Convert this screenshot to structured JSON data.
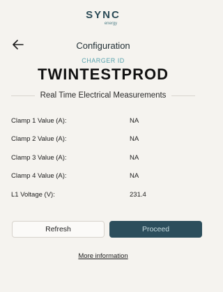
{
  "logo": {
    "word": "SYNC",
    "sub": "energy"
  },
  "header": {
    "title": "Configuration",
    "back_icon": "arrow-left-icon"
  },
  "charger": {
    "id_label": "CHARGER ID",
    "id_value": "TWINTESTPROD"
  },
  "section": {
    "title": "Real Time Electrical Measurements"
  },
  "measurements": [
    {
      "label": "Clamp 1 Value (A):",
      "value": "NA"
    },
    {
      "label": "Clamp 2 Value (A):",
      "value": "NA"
    },
    {
      "label": "Clamp 3 Value (A):",
      "value": "NA"
    },
    {
      "label": "Clamp 4 Value (A):",
      "value": "NA"
    },
    {
      "label": "L1 Voltage (V):",
      "value": "231.4"
    }
  ],
  "actions": {
    "refresh_label": "Refresh",
    "proceed_label": "Proceed"
  },
  "more_info": "More information",
  "colors": {
    "accent": "#2c4e5c",
    "label_accent": "#5aa3ae",
    "background": "#f5f3ef"
  }
}
